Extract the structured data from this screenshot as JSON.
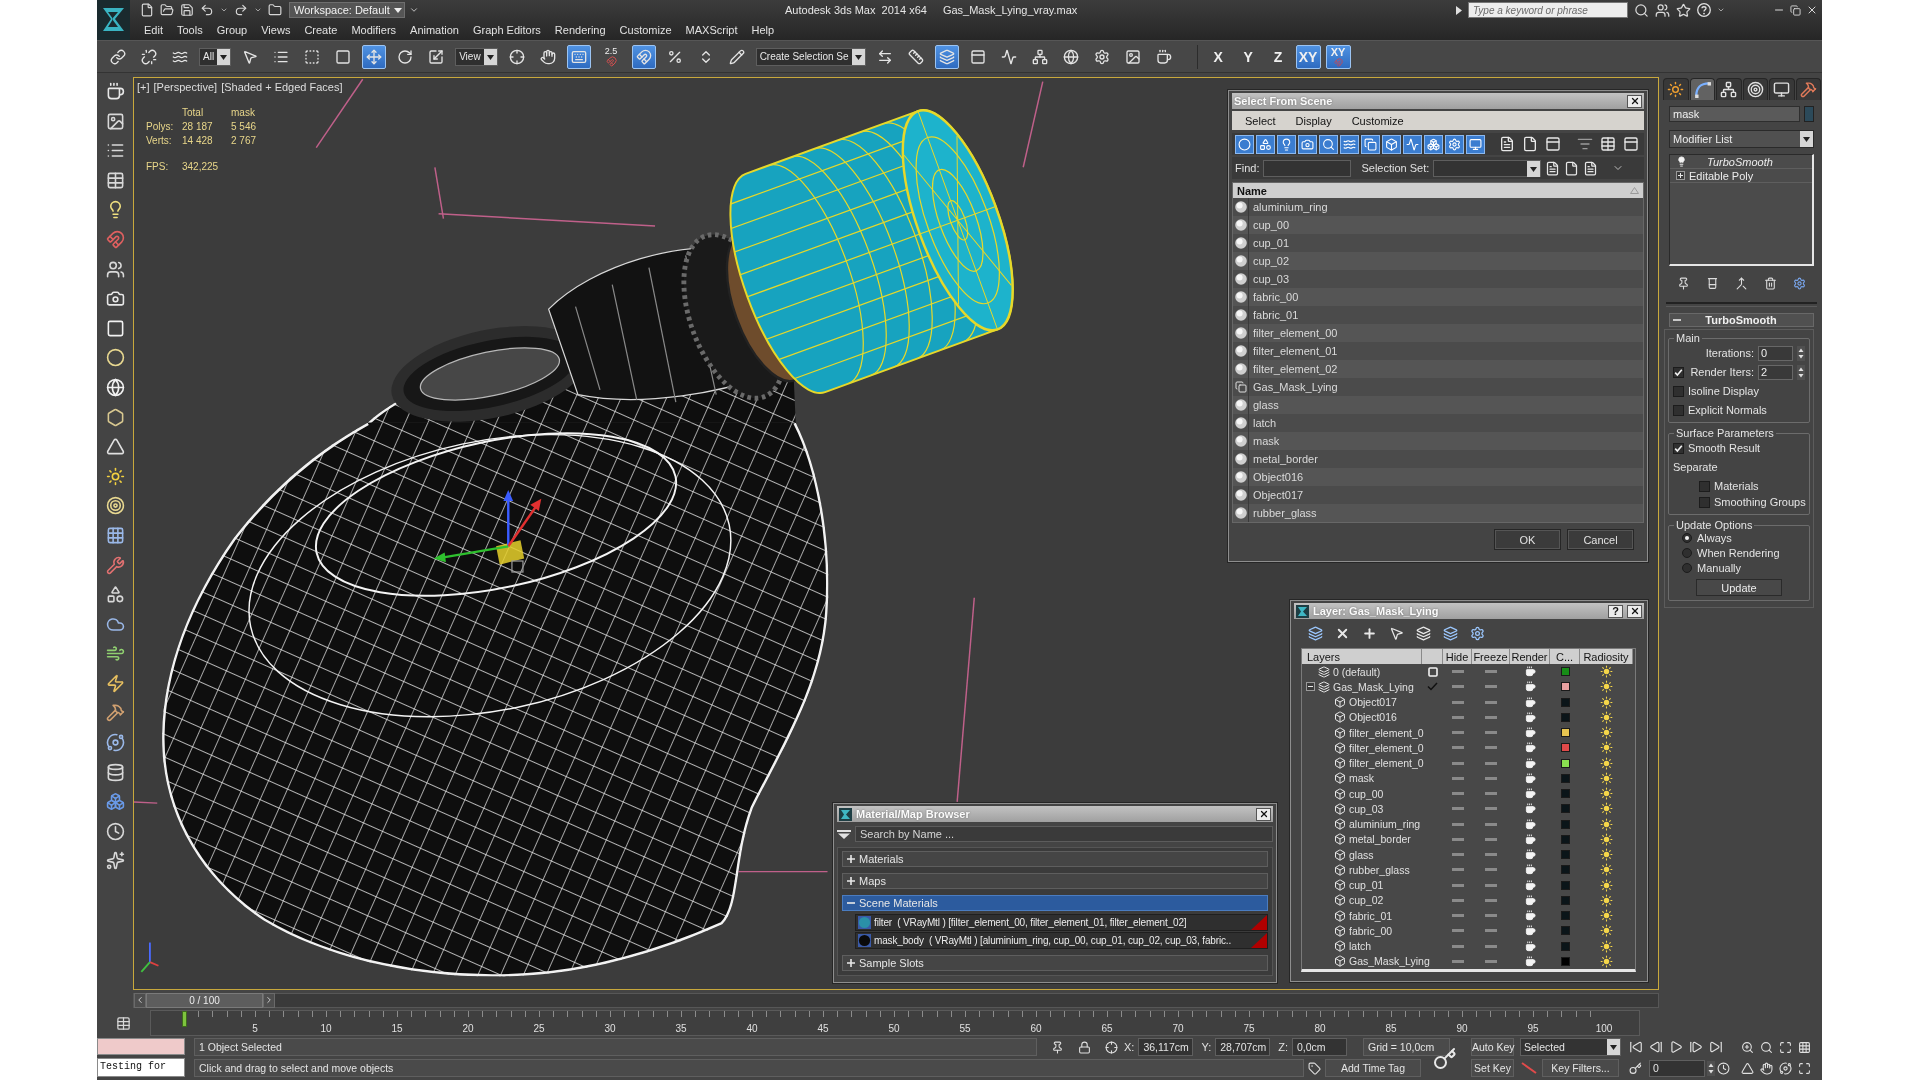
{
  "title_bar": {
    "workspace": "Workspace: Default",
    "app_title": "Autodesk 3ds Max  2014 x64",
    "file_name": "Gas_Mask_Lying_vray.max",
    "search": {
      "placeholder": "Type a keyword or phrase"
    }
  },
  "menu": [
    "Edit",
    "Tools",
    "Group",
    "Views",
    "Create",
    "Modifiers",
    "Animation",
    "Graph Editors",
    "Rendering",
    "Customize",
    "MAXScript",
    "Help"
  ],
  "main_toolbar": [
    {
      "kind": "icon",
      "selected": false
    },
    {
      "kind": "icon",
      "selected": false
    },
    {
      "kind": "icon",
      "selected": false
    },
    {
      "kind": "dropdown",
      "value": "All"
    },
    {
      "kind": "icon",
      "selected": false
    },
    {
      "kind": "icon",
      "selected": false
    },
    {
      "kind": "icon",
      "selected": false
    },
    {
      "kind": "icon",
      "selected": false
    },
    {
      "kind": "icon",
      "selected": true
    },
    {
      "kind": "icon",
      "selected": false
    },
    {
      "kind": "icon",
      "selected": false
    },
    {
      "kind": "dropdown",
      "value": "View"
    },
    {
      "kind": "icon",
      "selected": false
    },
    {
      "kind": "icon",
      "selected": false
    },
    {
      "kind": "icon",
      "selected": true
    },
    {
      "kind": "snap",
      "label": "2.5",
      "selected": false
    },
    {
      "kind": "icon",
      "selected": true
    },
    {
      "kind": "icon",
      "selected": false
    },
    {
      "kind": "icon",
      "selected": false
    },
    {
      "kind": "icon",
      "selected": false
    },
    {
      "kind": "dropdown",
      "value": "Create Selection Se"
    },
    {
      "kind": "icon",
      "selected": false
    },
    {
      "kind": "icon",
      "selected": false
    },
    {
      "kind": "icon",
      "selected": true
    },
    {
      "kind": "icon",
      "selected": false
    },
    {
      "kind": "icon",
      "selected": false
    },
    {
      "kind": "icon",
      "selected": false
    },
    {
      "kind": "icon",
      "selected": false
    },
    {
      "kind": "icon",
      "selected": false
    },
    {
      "kind": "icon",
      "selected": false
    },
    {
      "kind": "icon",
      "selected": false
    }
  ],
  "axis_constraints": [
    {
      "label": "X",
      "kind": "axis",
      "selected": false
    },
    {
      "label": "Y",
      "kind": "axis",
      "selected": false
    },
    {
      "label": "Z",
      "kind": "axis",
      "selected": false
    },
    {
      "label": "XY",
      "kind": "axis",
      "selected": true
    },
    {
      "label": "XY",
      "kind": "magnet",
      "selected": true
    }
  ],
  "viewport": {
    "labels": [
      "[+]",
      "[Perspective]",
      "[Shaded + Edged Faces]"
    ],
    "stats": {
      "columns": [
        "Total",
        "mask"
      ],
      "rows": [
        {
          "label": "Polys:",
          "values": [
            "28 187",
            "5 546"
          ]
        },
        {
          "label": "Verts:",
          "values": [
            "14 428",
            "2 767"
          ]
        }
      ]
    },
    "fps": {
      "label": "FPS:",
      "value": "342,225"
    }
  },
  "select_from_scene": {
    "title": "Select From Scene",
    "menu": [
      "Select",
      "Display",
      "Customize"
    ],
    "filters": [
      {
        "selected": true
      },
      {
        "selected": true
      },
      {
        "selected": true
      },
      {
        "selected": true
      },
      {
        "selected": true
      },
      {
        "selected": true
      },
      {
        "selected": true
      },
      {
        "selected": true
      },
      {
        "selected": true
      },
      {
        "selected": true
      },
      {
        "selected": true
      },
      {
        "selected": true
      }
    ],
    "find_label": "Find:",
    "selection_set_label": "Selection Set:",
    "column": "Name",
    "objects": [
      {
        "name": "aluminium_ring",
        "kind": "geometry"
      },
      {
        "name": "cup_00",
        "kind": "geometry"
      },
      {
        "name": "cup_01",
        "kind": "geometry"
      },
      {
        "name": "cup_02",
        "kind": "geometry"
      },
      {
        "name": "cup_03",
        "kind": "geometry"
      },
      {
        "name": "fabric_00",
        "kind": "geometry"
      },
      {
        "name": "fabric_01",
        "kind": "geometry"
      },
      {
        "name": "filter_element_00",
        "kind": "geometry"
      },
      {
        "name": "filter_element_01",
        "kind": "geometry"
      },
      {
        "name": "filter_element_02",
        "kind": "geometry"
      },
      {
        "name": "Gas_Mask_Lying",
        "kind": "group"
      },
      {
        "name": "glass",
        "kind": "geometry"
      },
      {
        "name": "latch",
        "kind": "geometry"
      },
      {
        "name": "mask",
        "kind": "geometry"
      },
      {
        "name": "metal_border",
        "kind": "geometry"
      },
      {
        "name": "Object016",
        "kind": "geometry"
      },
      {
        "name": "Object017",
        "kind": "geometry"
      },
      {
        "name": "rubber_glass",
        "kind": "geometry"
      }
    ],
    "buttons": [
      "OK",
      "Cancel"
    ]
  },
  "layer_manager": {
    "title": "Layer: Gas_Mask_Lying",
    "help": "?",
    "columns": [
      "Layers",
      "Hide",
      "Freeze",
      "Render",
      "C...",
      "Radiosity"
    ],
    "layers": [
      {
        "name": "0 (default)",
        "current": false,
        "hidden": false,
        "frozen": false,
        "render": true,
        "radiosity": true,
        "color": "#178c17"
      },
      {
        "name": "Gas_Mask_Lying",
        "current": true,
        "expanded": true,
        "hidden": false,
        "frozen": false,
        "render": true,
        "radiosity": true,
        "color": "#e8a0a0",
        "children": [
          {
            "name": "Object017",
            "hidden": false,
            "frozen": false,
            "render": true,
            "radiosity": true,
            "color": "#0b1519"
          },
          {
            "name": "Object016",
            "hidden": false,
            "frozen": false,
            "render": true,
            "radiosity": true,
            "color": "#0b1519"
          },
          {
            "name": "filter_element_0",
            "hidden": false,
            "frozen": false,
            "render": true,
            "radiosity": true,
            "color": "#e6c450"
          },
          {
            "name": "filter_element_0",
            "hidden": false,
            "frozen": false,
            "render": true,
            "radiosity": true,
            "color": "#e04a4a"
          },
          {
            "name": "filter_element_0",
            "hidden": false,
            "frozen": false,
            "render": true,
            "radiosity": true,
            "color": "#8ae050"
          },
          {
            "name": "mask",
            "hidden": false,
            "frozen": false,
            "render": true,
            "radiosity": true,
            "color": "#0b1519"
          },
          {
            "name": "cup_00",
            "hidden": false,
            "frozen": false,
            "render": true,
            "radiosity": true,
            "color": "#0b1519"
          },
          {
            "name": "cup_03",
            "hidden": false,
            "frozen": false,
            "render": true,
            "radiosity": true,
            "color": "#0b1519"
          },
          {
            "name": "aluminium_ring",
            "hidden": false,
            "frozen": false,
            "render": true,
            "radiosity": true,
            "color": "#0b1519"
          },
          {
            "name": "metal_border",
            "hidden": false,
            "frozen": false,
            "render": true,
            "radiosity": true,
            "color": "#0b1519"
          },
          {
            "name": "glass",
            "hidden": false,
            "frozen": false,
            "render": true,
            "radiosity": true,
            "color": "#0b1519"
          },
          {
            "name": "rubber_glass",
            "hidden": false,
            "frozen": false,
            "render": true,
            "radiosity": true,
            "color": "#0b1519"
          },
          {
            "name": "cup_01",
            "hidden": false,
            "frozen": false,
            "render": true,
            "radiosity": true,
            "color": "#0b1519"
          },
          {
            "name": "cup_02",
            "hidden": false,
            "frozen": false,
            "render": true,
            "radiosity": true,
            "color": "#0b1519"
          },
          {
            "name": "fabric_01",
            "hidden": false,
            "frozen": false,
            "render": true,
            "radiosity": true,
            "color": "#0b1519"
          },
          {
            "name": "fabric_00",
            "hidden": false,
            "frozen": false,
            "render": true,
            "radiosity": true,
            "color": "#0b1519"
          },
          {
            "name": "latch",
            "hidden": false,
            "frozen": false,
            "render": true,
            "radiosity": true,
            "color": "#0b1519"
          },
          {
            "name": "Gas_Mask_Lying",
            "hidden": false,
            "frozen": false,
            "render": true,
            "radiosity": true,
            "color": "#000000"
          }
        ]
      }
    ]
  },
  "material_browser": {
    "title": "Material/Map Browser",
    "search": {
      "placeholder": "Search by Name ..."
    },
    "groups": [
      {
        "label": "Materials",
        "expanded": false,
        "selected": false
      },
      {
        "label": "Maps",
        "expanded": false,
        "selected": false
      },
      {
        "label": "Scene Materials",
        "expanded": true,
        "selected": true,
        "items": [
          {
            "label": "filter  ( VRayMtl ) [filter_element_00, filter_element_01, filter_element_02]",
            "color": "#2a90a8",
            "in_scene": true
          },
          {
            "label": "mask_body  ( VRayMtl ) [aluminium_ring, cup_00, cup_01, cup_02, cup_03, fabric..",
            "color": "#0a0a0a",
            "in_scene": true
          }
        ]
      },
      {
        "label": "Sample Slots",
        "expanded": false,
        "selected": false
      }
    ]
  },
  "command_panel": {
    "tabs": [
      {
        "selected": false
      },
      {
        "selected": true
      },
      {
        "selected": false
      },
      {
        "selected": false
      },
      {
        "selected": false
      },
      {
        "selected": false
      }
    ],
    "object_name": "mask",
    "modifier_list": "Modifier List",
    "stack": [
      {
        "name": "TurboSmooth",
        "kind": "modifier",
        "enabled": true
      },
      {
        "name": "Editable Poly",
        "kind": "object",
        "expanded": false
      }
    ],
    "rollout": {
      "title": "TurboSmooth",
      "expanded": true,
      "groups": [
        {
          "title": "Main",
          "controls": [
            {
              "kind": "spinner",
              "label": "Iterations:",
              "value": "0"
            },
            {
              "kind": "check_spinner",
              "label": "Render Iters:",
              "checked": true,
              "value": "2"
            },
            {
              "kind": "checkbox",
              "label": "Isoline Display",
              "checked": false
            },
            {
              "kind": "checkbox",
              "label": "Explicit Normals",
              "checked": false
            }
          ]
        },
        {
          "title": "Surface Parameters",
          "controls": [
            {
              "kind": "checkbox",
              "label": "Smooth Result",
              "checked": true
            },
            {
              "kind": "heading",
              "label": "Separate",
              "children": [
                {
                  "kind": "checkbox",
                  "label": "Materials",
                  "checked": false
                },
                {
                  "kind": "checkbox",
                  "label": "Smoothing Groups",
                  "checked": false
                }
              ]
            }
          ]
        },
        {
          "title": "Update Options",
          "controls": [
            {
              "kind": "radio",
              "label": "Always",
              "selected": true
            },
            {
              "kind": "radio",
              "label": "When Rendering",
              "selected": false
            },
            {
              "kind": "radio",
              "label": "Manually",
              "selected": false
            },
            {
              "kind": "button",
              "label": "Update"
            }
          ]
        }
      ]
    }
  },
  "time_slider": {
    "label": "0 / 100",
    "level": 0
  },
  "track_bar": {
    "ticks": [
      "5",
      "10",
      "15",
      "20",
      "25",
      "30",
      "35",
      "40",
      "45",
      "50",
      "55",
      "60",
      "65",
      "70",
      "75",
      "80",
      "85",
      "90",
      "95",
      "100"
    ]
  },
  "status_bar": {
    "listener": {
      "text": "Testing for"
    },
    "selection": "1 Object Selected",
    "prompt": "Click and drag to select and move objects",
    "coords": [
      {
        "label": "X:",
        "value": "36,117cm"
      },
      {
        "label": "Y:",
        "value": "28,707cm"
      },
      {
        "label": "Z:",
        "value": "0,0cm"
      }
    ],
    "grid": "Grid = 10,0cm",
    "time_tag": "Add Time Tag",
    "auto_key": {
      "label": "Auto Key",
      "on": false
    },
    "set_key": "Set Key",
    "key_mode": "Selected",
    "key_filters": "Key Filters...",
    "frame": "0"
  }
}
